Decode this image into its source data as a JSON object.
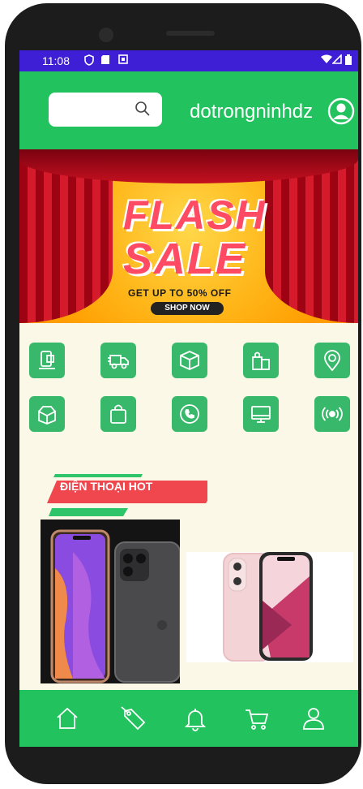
{
  "status_bar": {
    "time": "11:08",
    "icons": [
      "privacy-shield-icon",
      "sd-card-icon",
      "notification-a-icon",
      "wifi-icon",
      "signal-icon",
      "battery-icon"
    ]
  },
  "header": {
    "search_placeholder": "",
    "username": "dotrongninhdz"
  },
  "banner": {
    "line1": "FLASH",
    "line2": "SALE",
    "offer": "GET UP TO 50% OFF",
    "button": "SHOP NOW"
  },
  "categories": [
    "tablet-icon",
    "delivery-truck-icon",
    "box-icon",
    "shopping-bags-icon",
    "location-pin-icon",
    "open-box-icon",
    "shopping-bag-icon",
    "phone-call-icon",
    "monitor-icon",
    "radio-signal-icon"
  ],
  "section": {
    "title": "ĐIỆN THOẠI HOT"
  },
  "bottom_nav": [
    "home-icon",
    "sale-tag-icon",
    "bell-icon",
    "cart-icon",
    "user-icon"
  ],
  "colors": {
    "primary_green": "#22c35e",
    "status_bar": "#3f1fd6",
    "accent_red": "#f0474e",
    "content_bg": "#fbf8e7"
  }
}
